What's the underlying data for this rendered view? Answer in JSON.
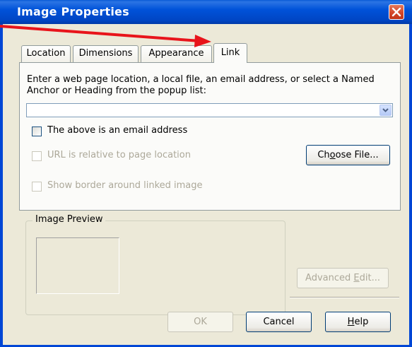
{
  "window": {
    "title": "Image Properties"
  },
  "tabs": [
    {
      "label": "Location",
      "active": false
    },
    {
      "label": "Dimensions",
      "active": false
    },
    {
      "label": "Appearance",
      "active": false
    },
    {
      "label": "Link",
      "active": true
    }
  ],
  "link": {
    "prompt": "Enter a web page location, a local file, an email address, or select a Named Anchor or Heading from the popup list:",
    "url_value": "",
    "email_checkbox": {
      "label": "The above is an email address",
      "checked": false,
      "enabled": true
    },
    "relative_checkbox": {
      "label": "URL is relative to page location",
      "checked": false,
      "enabled": false
    },
    "border_checkbox": {
      "label": "Show border around linked image",
      "checked": false,
      "enabled": false
    },
    "choose_file_label": "Choose File...",
    "choose_file_mnemonic_prefix": "Ch",
    "choose_file_mnemonic": "o",
    "choose_file_mnemonic_suffix": "ose File..."
  },
  "preview": {
    "title": "Image Preview"
  },
  "advanced_edit": {
    "prefix": "Advanced ",
    "mnemonic": "E",
    "suffix": "dit..."
  },
  "buttons": {
    "ok": "OK",
    "cancel": "Cancel",
    "help_mnemonic": "H",
    "help_suffix": "elp"
  },
  "colors": {
    "title_bar": "#0054e3",
    "annotation_arrow": "#e8141b",
    "dialog_bg": "#ece9d8"
  },
  "icons": {
    "close": "close-icon",
    "dropdown": "chevron-down-icon"
  }
}
